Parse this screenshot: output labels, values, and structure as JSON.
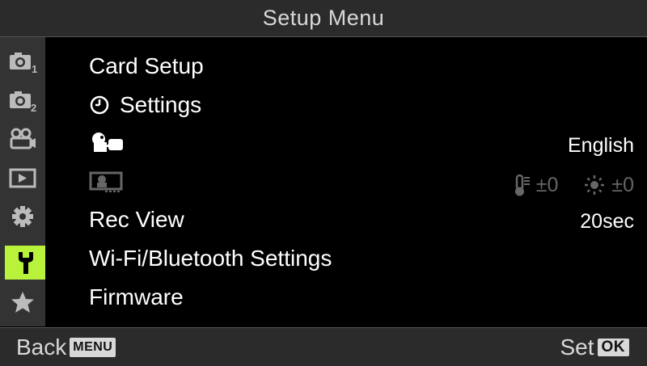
{
  "header": {
    "title": "Setup Menu"
  },
  "sidebar": {
    "tabs": [
      {
        "icon": "shooting-menu-1-icon",
        "badge": "1"
      },
      {
        "icon": "shooting-menu-2-icon",
        "badge": "2"
      },
      {
        "icon": "video-menu-icon"
      },
      {
        "icon": "playback-menu-icon"
      },
      {
        "icon": "custom-menu-gear-icon"
      },
      {
        "icon": "setup-menu-wrench-icon",
        "active": true
      },
      {
        "icon": "my-menu-star-icon"
      }
    ],
    "active_color": "#b9f23a"
  },
  "menu": {
    "items": [
      {
        "label": "Card Setup"
      },
      {
        "label": "Settings",
        "icon": "clock-icon"
      },
      {
        "icon": "language-icon",
        "value": "English"
      },
      {
        "icon": "monitor-adjust-icon",
        "disabled": true,
        "temp_value": "±0",
        "brightness_value": "±0"
      },
      {
        "label": "Rec View",
        "value": "20sec"
      },
      {
        "label": "Wi-Fi/Bluetooth Settings"
      },
      {
        "label": "Firmware"
      }
    ]
  },
  "footer": {
    "back_label": "Back",
    "back_key": "MENU",
    "set_label": "Set",
    "set_key": "OK"
  }
}
